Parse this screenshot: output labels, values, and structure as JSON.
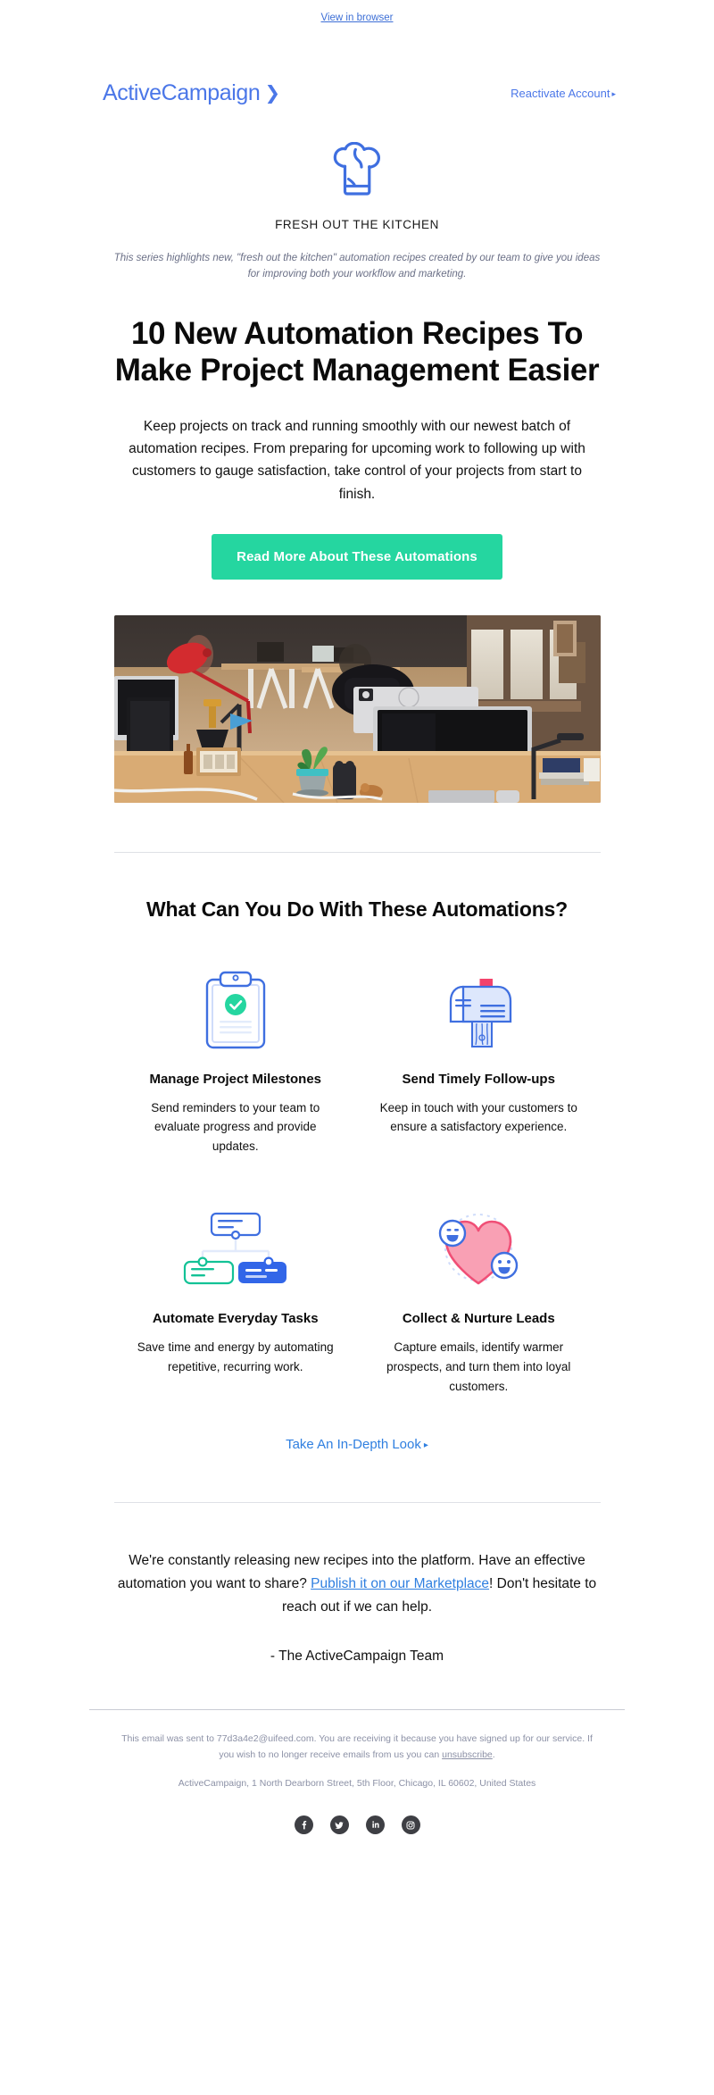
{
  "preheader": {
    "view_in_browser": "View in browser"
  },
  "header": {
    "brand_name": "ActiveCampaign",
    "brand_chevron": "❯",
    "reactivate_label": "Reactivate Account",
    "caret": "▸",
    "brand_color": "#4b77e8"
  },
  "kitchen": {
    "icon": "chef-hat-icon",
    "label": "FRESH OUT THE KITCHEN",
    "series_note": "This series highlights new, \"fresh out the kitchen\" automation recipes created by our team to give you ideas for improving both your workflow and marketing."
  },
  "hero": {
    "headline": "10 New Automation Recipes To Make Project Management Easier",
    "intro": "Keep projects on track and running smoothly with our newest batch of automation recipes. From preparing for upcoming work to following up with customers to gauge satisfaction, take control of your projects from start to finish.",
    "cta_label": "Read More About These Automations",
    "cta_color": "#25d6a0",
    "image_alt": "office-desk-photo"
  },
  "features": {
    "heading": "What Can You Do With These Automations?",
    "items": [
      {
        "icon": "clipboard-check-icon",
        "title": "Manage Project Milestones",
        "desc": "Send reminders to your team to evaluate progress and provide updates."
      },
      {
        "icon": "mailbox-icon",
        "title": "Send Timely Follow-ups",
        "desc": "Keep in touch with your customers to ensure a satisfactory experience."
      },
      {
        "icon": "automation-flow-icon",
        "title": "Automate Everyday Tasks",
        "desc": "Save time and energy by automating repetitive, recurring work."
      },
      {
        "icon": "heart-smiley-icon",
        "title": "Collect & Nurture Leads",
        "desc": "Capture emails, identify warmer prospects, and turn them into loyal customers."
      }
    ],
    "indepth_label": "Take An In-Depth Look",
    "indepth_caret": "▸"
  },
  "closing": {
    "text_before_link": "We're constantly releasing new recipes into the platform. Have an effective automation you want to share? ",
    "link_label": "Publish it on our Marketplace",
    "text_after_link": "! Don't hesitate to reach out if we can help.",
    "signature": "- The ActiveCampaign Team"
  },
  "footer": {
    "legal_before_link": "This email was sent to 77d3a4e2@uifeed.com. You are receiving it because you have signed up for our service. If you wish to no longer receive emails from us you can ",
    "unsubscribe_label": "unsubscribe",
    "legal_after_link": ".",
    "address": "ActiveCampaign, 1 North Dearborn Street, 5th Floor, Chicago, IL 60602, United States",
    "social": [
      {
        "name": "facebook-icon",
        "label": "Facebook"
      },
      {
        "name": "twitter-icon",
        "label": "Twitter"
      },
      {
        "name": "linkedin-icon",
        "label": "LinkedIn"
      },
      {
        "name": "instagram-icon",
        "label": "Instagram"
      }
    ]
  }
}
